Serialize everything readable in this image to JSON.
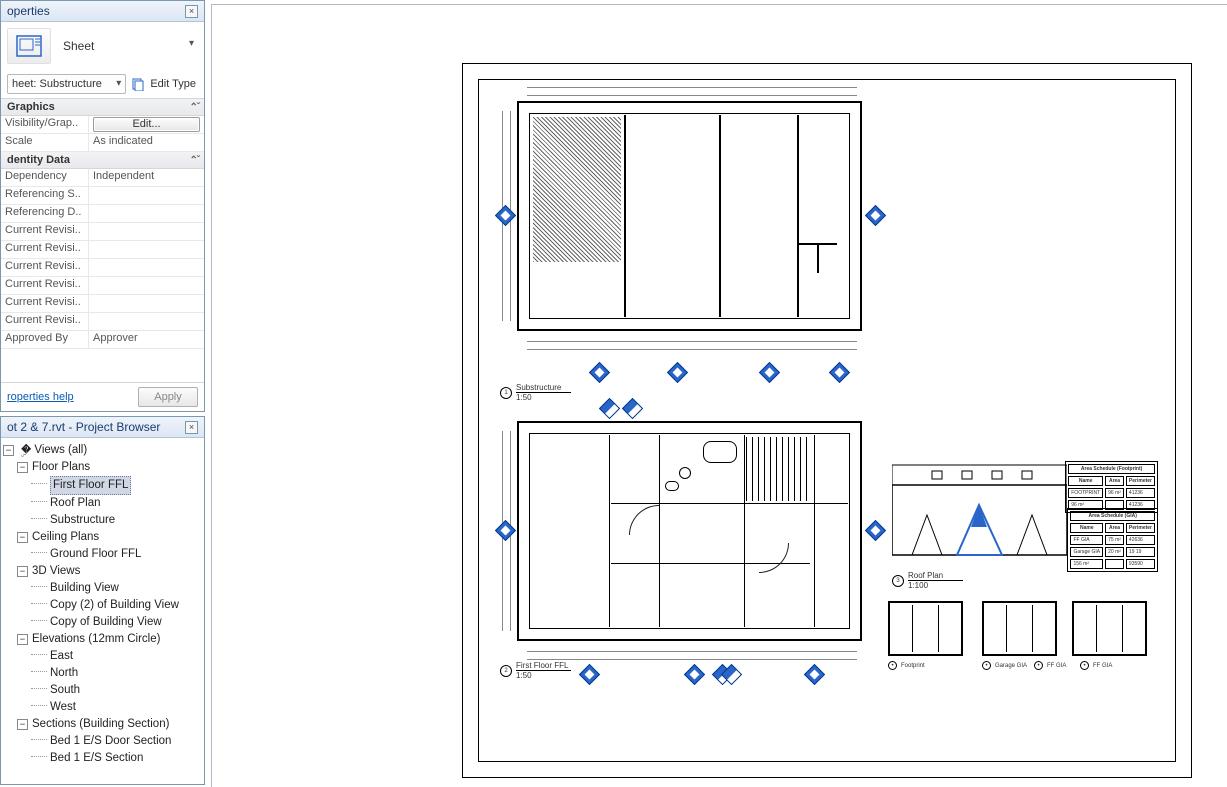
{
  "properties_panel": {
    "title": "operties",
    "type_label": "Sheet",
    "instance_selector": "heet: Substructure",
    "edit_type_label": "Edit Type",
    "groups": {
      "graphics": {
        "title": "Graphics",
        "rows": [
          {
            "label": "Visibility/Grap..",
            "value": "Edit...",
            "is_button": true
          },
          {
            "label": "Scale",
            "value": "As indicated"
          }
        ]
      },
      "identity": {
        "title": "dentity Data",
        "rows": [
          {
            "label": "Dependency",
            "value": "Independent"
          },
          {
            "label": "Referencing S..",
            "value": ""
          },
          {
            "label": "Referencing D..",
            "value": ""
          },
          {
            "label": "Current Revisi..",
            "value": ""
          },
          {
            "label": "Current Revisi..",
            "value": ""
          },
          {
            "label": "Current Revisi..",
            "value": ""
          },
          {
            "label": "Current Revisi..",
            "value": ""
          },
          {
            "label": "Current Revisi..",
            "value": ""
          },
          {
            "label": "Current Revisi..",
            "value": ""
          },
          {
            "label": "Approved By",
            "value": "Approver"
          }
        ]
      }
    },
    "help_link": "roperties help",
    "apply_label": "Apply"
  },
  "browser_panel": {
    "title": "ot 2 & 7.rvt - Project Browser",
    "root": "Views (all)",
    "floor_plans": {
      "label": "Floor Plans",
      "items": [
        "First Floor FFL",
        "Roof Plan",
        "Substructure"
      ],
      "selected": "First Floor FFL"
    },
    "ceiling_plans": {
      "label": "Ceiling Plans",
      "items": [
        "Ground Floor FFL"
      ]
    },
    "threeD": {
      "label": "3D Views",
      "items": [
        "Building View",
        "Copy (2) of Building View",
        "Copy of Building View"
      ]
    },
    "elevations": {
      "label": "Elevations (12mm Circle)",
      "items": [
        "East",
        "North",
        "South",
        "West"
      ]
    },
    "sections": {
      "label": "Sections (Building Section)",
      "items": [
        "Bed 1 E/S Door Section",
        "Bed 1 E/S Section"
      ]
    }
  },
  "sheet": {
    "view1_title": "Substructure",
    "view1_scale": "1:50",
    "view2_title": "First Floor FFL",
    "view2_scale": "1:50",
    "roof_title": "Roof Plan",
    "roof_scale": "1:100",
    "mini_titles": [
      "Footprint",
      "Garage GIA",
      "FF GIA",
      "FF GIA"
    ],
    "schedule1": {
      "title": "Area Schedule (Footprint)",
      "headers": [
        "Name",
        "Area",
        "Perimeter"
      ],
      "rows": [
        [
          "FOOTPRINT",
          "96 m²",
          "41236"
        ],
        [
          "96 m²",
          "",
          "41236"
        ]
      ]
    },
    "schedule2": {
      "title": "Area Schedule (GIA)",
      "headers": [
        "Name",
        "Area",
        "Perimeter"
      ],
      "rows": [
        [
          "FF GIA",
          "75 m²",
          "42636"
        ],
        [
          "Garage GIA",
          "20 m²",
          "19 19"
        ],
        [
          "156 m²",
          "",
          "93590"
        ]
      ]
    }
  }
}
